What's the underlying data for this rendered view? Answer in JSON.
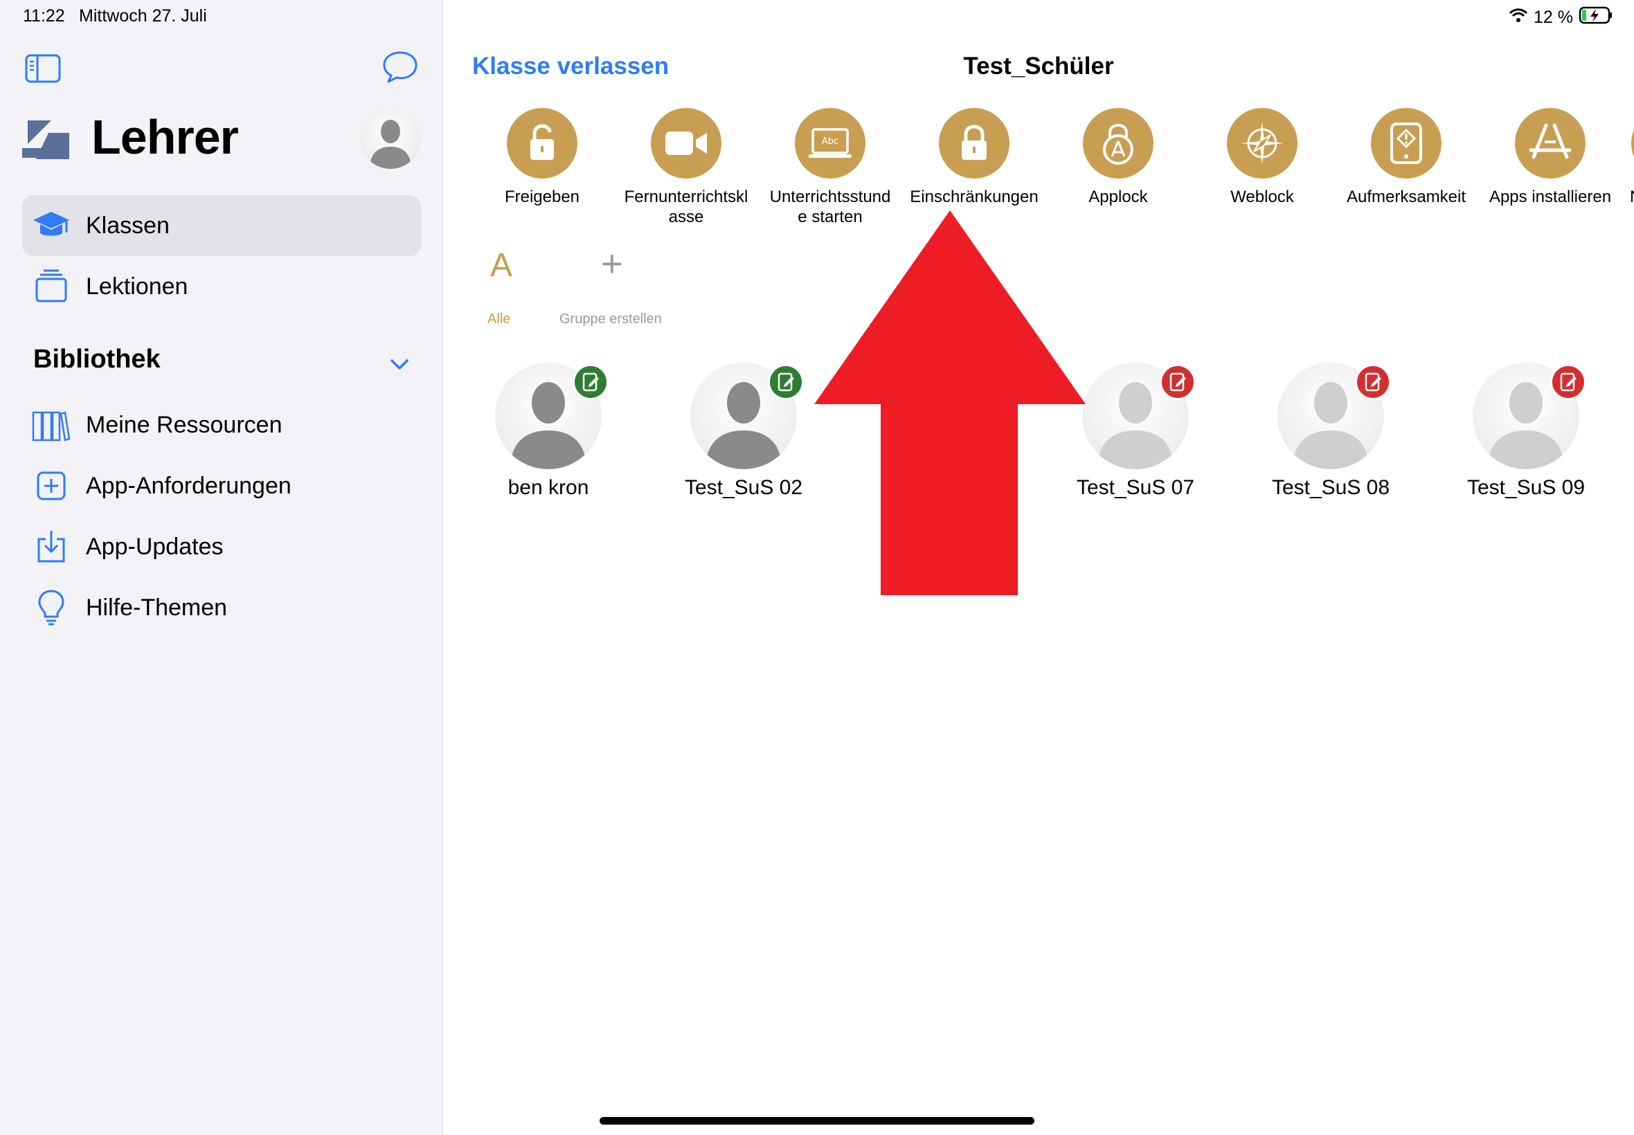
{
  "status_bar": {
    "time": "11:22",
    "date": "Mittwoch 27. Juli",
    "battery": "12 %"
  },
  "sidebar": {
    "app_title": "Lehrer",
    "items": [
      {
        "label": "Klassen",
        "icon": "graduation-cap-icon",
        "selected": true
      },
      {
        "label": "Lektionen",
        "icon": "stack-icon",
        "selected": false
      }
    ],
    "section_title": "Bibliothek",
    "library_items": [
      {
        "label": "Meine Ressourcen",
        "icon": "books-icon"
      },
      {
        "label": "App-Anforderungen",
        "icon": "plus-square-icon"
      },
      {
        "label": "App-Updates",
        "icon": "download-icon"
      },
      {
        "label": "Hilfe-Themen",
        "icon": "lightbulb-icon"
      }
    ]
  },
  "header": {
    "leave_label": "Klasse verlassen",
    "class_title": "Test_Schüler"
  },
  "actions": [
    {
      "label": "Freigeben",
      "icon": "unlock-icon"
    },
    {
      "label": "Fernunterrichtskl\nasse",
      "icon": "video-camera-icon"
    },
    {
      "label": "Unterrichtsstund\ne starten",
      "icon": "laptop-abc-icon"
    },
    {
      "label": "Einschränkungen",
      "icon": "lock-icon"
    },
    {
      "label": "Applock",
      "icon": "app-lock-icon"
    },
    {
      "label": "Weblock",
      "icon": "compass-icon"
    },
    {
      "label": "Aufmerksamkeit",
      "icon": "tablet-alert-icon"
    },
    {
      "label": "Apps installieren",
      "icon": "app-store-icon"
    },
    {
      "label": "Na",
      "icon": "partial-icon"
    }
  ],
  "groups": [
    {
      "symbol": "A",
      "label": "Alle"
    },
    {
      "symbol": "+",
      "label": "Gruppe erstellen"
    }
  ],
  "students": [
    {
      "name": "ben kron",
      "status": "online"
    },
    {
      "name": "Test_SuS 02",
      "status": "online"
    },
    {
      "name": "Test_SuS 07",
      "status": "offline"
    },
    {
      "name": "Test_SuS 08",
      "status": "offline"
    },
    {
      "name": "Test_SuS 09",
      "status": "offline"
    }
  ],
  "colors": {
    "accent_blue": "#2f7cf6",
    "action_gold": "#c89e52",
    "badge_green": "#2e7d32",
    "badge_red": "#d32f2f",
    "arrow_red": "#ee1c25"
  }
}
